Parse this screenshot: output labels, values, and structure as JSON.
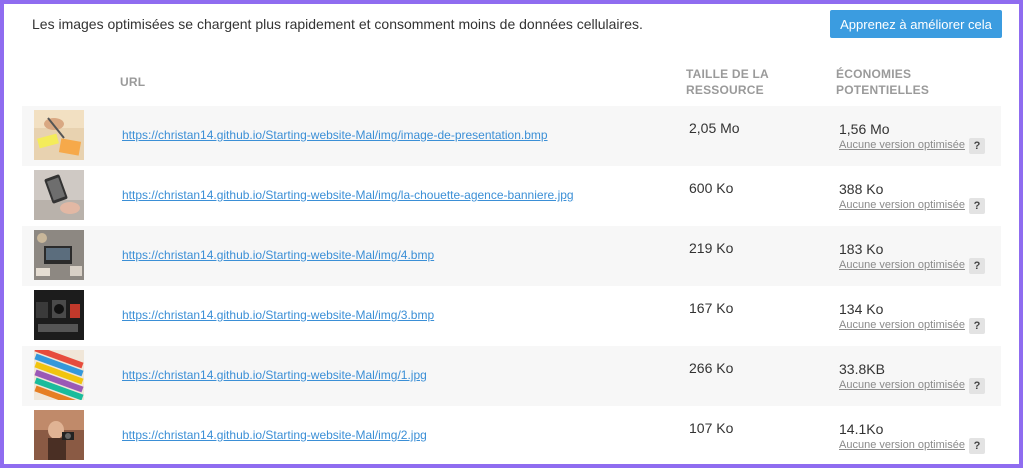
{
  "header": {
    "intro_text": "Les images optimisées se chargent plus rapidement et consomment moins de données cellulaires.",
    "learn_button": "Apprenez à améliorer cela"
  },
  "columns": {
    "url": "URL",
    "size_line1": "TAILLE DE LA",
    "size_line2": "RESSOURCE",
    "savings_line1": "ÉCONOMIES",
    "savings_line2": "POTENTIELLES"
  },
  "help_symbol": "?",
  "rows": [
    {
      "url": "https://christan14.github.io/Starting-website-Mal/img/image-de-presentation.bmp",
      "size": "2,05 Mo",
      "savings": "1,56 Mo",
      "note": "Aucune version optimisée",
      "thumb": "hands-writing-photo"
    },
    {
      "url": "https://christan14.github.io/Starting-website-Mal/img/la-chouette-agence-banniere.jpg",
      "size": "600 Ko",
      "savings": "388 Ko",
      "note": "Aucune version optimisée",
      "thumb": "phone-desk-photo"
    },
    {
      "url": "https://christan14.github.io/Starting-website-Mal/img/4.bmp",
      "size": "219 Ko",
      "savings": "183 Ko",
      "note": "Aucune version optimisée",
      "thumb": "workspace-photo"
    },
    {
      "url": "https://christan14.github.io/Starting-website-Mal/img/3.bmp",
      "size": "167 Ko",
      "savings": "134 Ko",
      "note": "Aucune version optimisée",
      "thumb": "camera-gear-photo"
    },
    {
      "url": "https://christan14.github.io/Starting-website-Mal/img/1.jpg",
      "size": "266 Ko",
      "savings": "33.8KB",
      "note": "Aucune version optimisée",
      "thumb": "colored-fabric-photo"
    },
    {
      "url": "https://christan14.github.io/Starting-website-Mal/img/2.jpg",
      "size": "107 Ko",
      "savings": "14.1Ko",
      "note": "Aucune version optimisée",
      "thumb": "photographer-photo"
    }
  ],
  "colors": {
    "frame": "#8f6cf0",
    "button": "#3b9ce0",
    "link": "#3b8fd6",
    "row_alt": "#f7f7f7"
  }
}
